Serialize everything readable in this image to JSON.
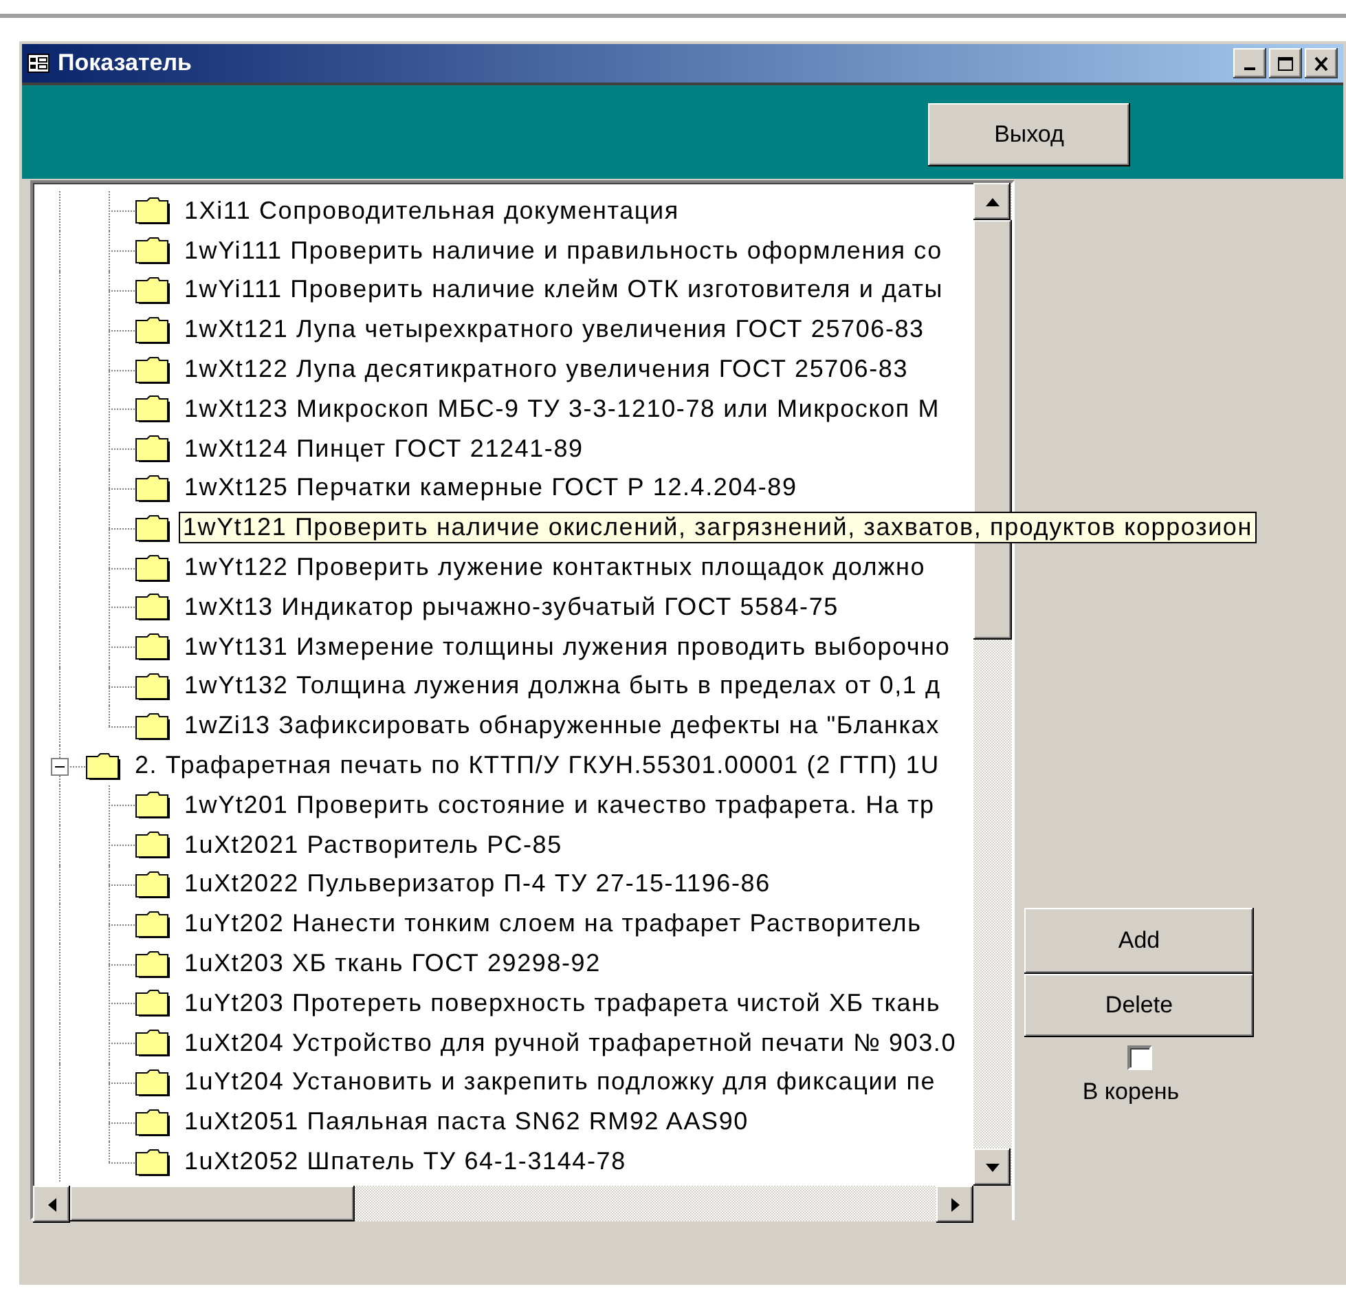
{
  "window": {
    "title": "Показатель"
  },
  "exit_button": {
    "label": "Выход"
  },
  "tree": {
    "continued_children": [
      {
        "label": "1Xi11 Сопроводительная документация",
        "hovered": false
      },
      {
        "label": "1wYi111 Проверить наличие и правильность оформления со",
        "hovered": false
      },
      {
        "label": "1wYi111 Проверить  наличие клейм ОТК изготовителя и даты",
        "hovered": false
      },
      {
        "label": "1wXt121 Лупа четырехкратного увеличения ГОСТ 25706-83",
        "hovered": false
      },
      {
        "label": "1wXt122 Лупа десятикратного увеличения ГОСТ 25706-83",
        "hovered": false
      },
      {
        "label": "1wXt123 Микроскоп МБС-9 ТУ 3-3-1210-78 или Микроскоп М",
        "hovered": false
      },
      {
        "label": "1wXt124 Пинцет ГОСТ 21241-89",
        "hovered": false
      },
      {
        "label": "1wXt125 Перчатки камерные ГОСТ Р 12.4.204-89",
        "hovered": false
      },
      {
        "label": "1wYt121 Проверить наличие окислений, загрязнений, захватов, продуктов коррозион",
        "hovered": true
      },
      {
        "label": "1wYt122 Проверить лужение контактных площадок должно",
        "hovered": false
      },
      {
        "label": "1wXt13 Индикатор рычажно-зубчатый ГОСТ 5584-75",
        "hovered": false
      },
      {
        "label": "1wYt131 Измерение толщины лужения проводить выборочно",
        "hovered": false
      },
      {
        "label": "1wYt132 Толщина лужения должна быть в пределах от 0,1 д",
        "hovered": false
      },
      {
        "label": "1wZi13 Зафиксировать обнаруженные дефекты на \"Бланках",
        "hovered": false
      }
    ],
    "items": [
      {
        "label": "2. Трафаретная печать по КТТП/У ГКУН.55301.00001 (2 ГТП) 1U",
        "expanded": true,
        "hovered": false,
        "children": [
          {
            "label": "1wYt201 Проверить состояние и качество трафарета. На тр",
            "hovered": false
          },
          {
            "label": "1uXt2021 Растворитель РС-85",
            "hovered": false
          },
          {
            "label": "1uXt2022 Пульверизатор П-4 ТУ 27-15-1196-86",
            "hovered": false
          },
          {
            "label": "1uYt202 Нанести тонким слоем на трафарет Растворитель",
            "hovered": false
          },
          {
            "label": "1uXt203 ХБ ткань ГОСТ 29298-92",
            "hovered": false
          },
          {
            "label": "1uYt203 Протереть поверхность трафарета чистой ХБ ткань",
            "hovered": false
          },
          {
            "label": "1uXt204 Устройство для ручной трафаретной печати № 903.0",
            "hovered": false
          },
          {
            "label": "1uYt204 Установить и закрепить подложку для фиксации пе",
            "hovered": false
          },
          {
            "label": "1uXt2051 Паяльная паста  SN62 RM92 AAS90",
            "hovered": false
          },
          {
            "label": "1uXt2052 Шпатель ТУ 64-1-3144-78",
            "hovered": false
          }
        ]
      }
    ]
  },
  "buttons": [
    {
      "label": "Add"
    },
    {
      "label": "Delete"
    }
  ],
  "root_checkbox": {
    "label": "В корень",
    "checked": false
  }
}
